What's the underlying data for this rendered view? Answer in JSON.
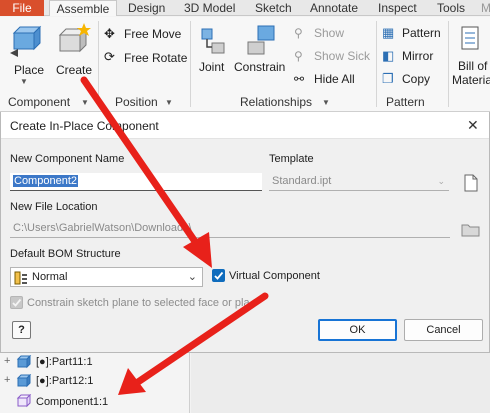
{
  "tabs": {
    "file": "File",
    "assemble": "Assemble",
    "design": "Design",
    "model3d": "3D Model",
    "sketch": "Sketch",
    "annotate": "Annotate",
    "inspect": "Inspect",
    "tools": "Tools",
    "more": "M"
  },
  "ribbon": {
    "place": "Place",
    "create": "Create",
    "free_move": "Free Move",
    "free_rotate": "Free Rotate",
    "joint": "Joint",
    "constrain": "Constrain",
    "show": "Show",
    "show_sick": "Show Sick",
    "hide_all": "Hide All",
    "pattern": "Pattern",
    "mirror": "Mirror",
    "copy": "Copy",
    "bom_line1": "Bill of",
    "bom_line2": "Materia",
    "groups": {
      "component": "Component",
      "position": "Position",
      "relationships": "Relationships",
      "pattern": "Pattern"
    }
  },
  "dialog": {
    "title": "Create In-Place Component",
    "name_label": "New Component Name",
    "name_value": "Component2",
    "template_label": "Template",
    "template_value": "Standard.ipt",
    "location_label": "New File Location",
    "location_value": "C:\\Users\\GabrielWatson\\Downloads\\",
    "bom_label": "Default BOM Structure",
    "bom_value": "Normal",
    "virtual_label": "Virtual Component",
    "virtual_checked": true,
    "constrain_label": "Constrain sketch plane to selected face or plane",
    "constrain_checked": true,
    "help_icon_text": "?",
    "ok": "OK",
    "cancel": "Cancel"
  },
  "browser": {
    "items": [
      {
        "label": "[●]:Part11:1"
      },
      {
        "label": "[●]:Part12:1"
      },
      {
        "label": "Component1:1"
      }
    ]
  },
  "annotation": {
    "arrow_color": "#e8211a"
  }
}
